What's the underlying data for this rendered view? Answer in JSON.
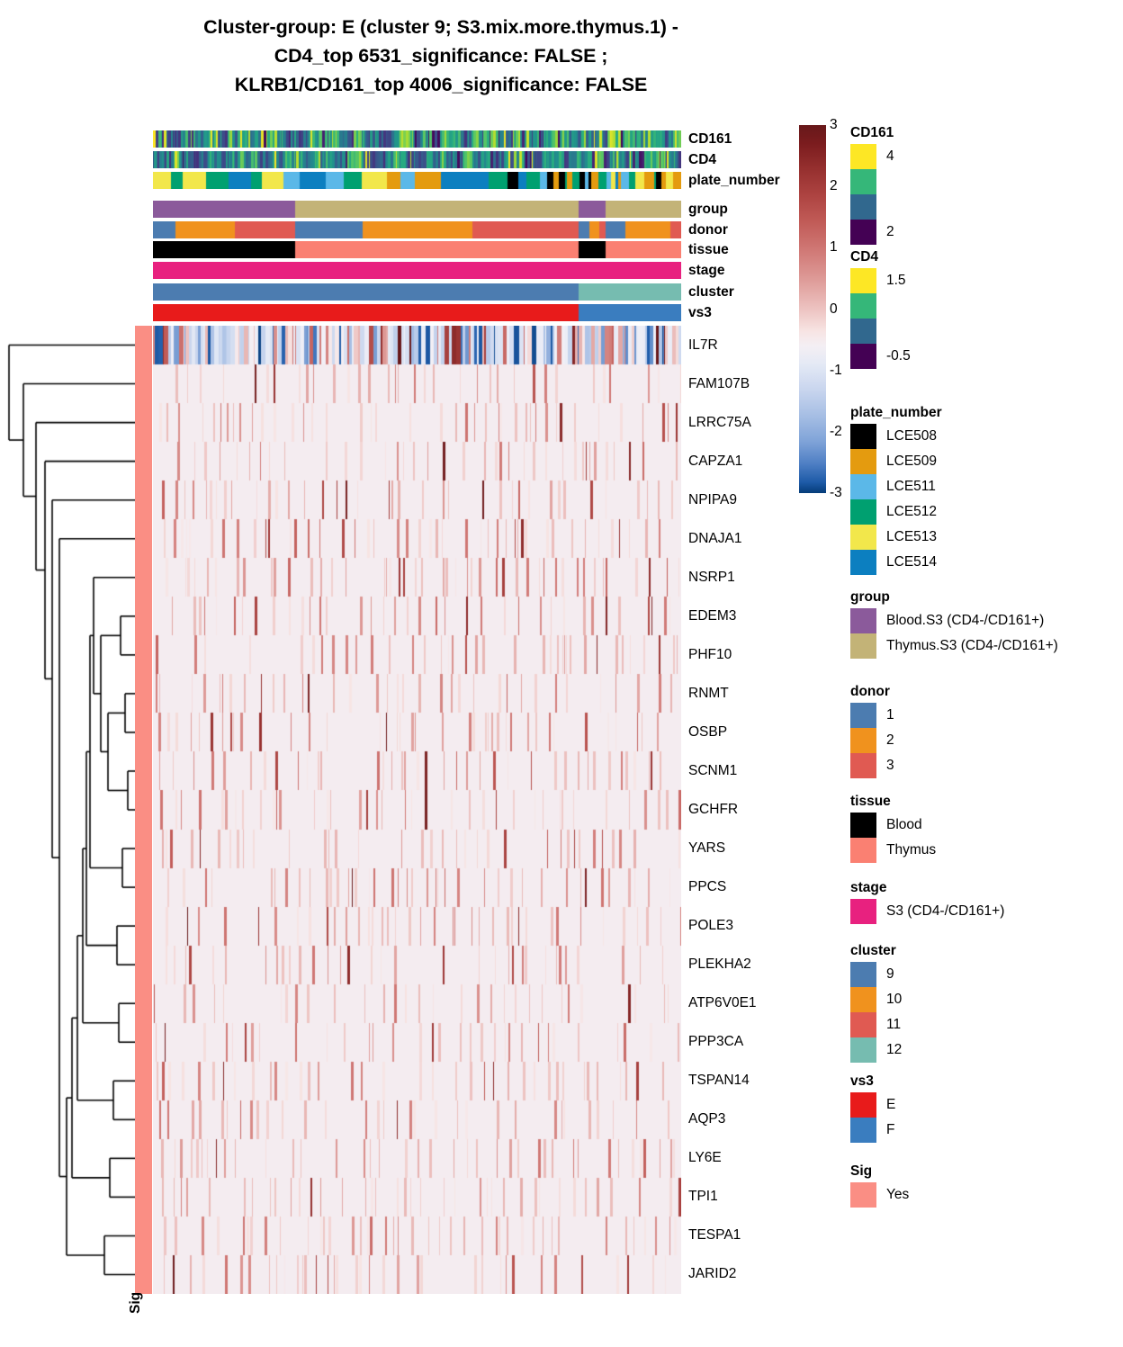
{
  "title": {
    "line1": "Cluster-group: E (cluster 9; S3.mix.more.thymus.1) -",
    "line2": "CD4_top 6531_significance: FALSE ;",
    "line3": "KLRB1/CD161_top 4006_significance: FALSE"
  },
  "column_annotations": [
    {
      "name": "CD161",
      "type": "continuous",
      "colormap": "viridis"
    },
    {
      "name": "CD4",
      "type": "continuous",
      "colormap": "viridis"
    },
    {
      "name": "plate_number",
      "type": "categorical"
    },
    {
      "name": "group",
      "type": "categorical"
    },
    {
      "name": "donor",
      "type": "categorical"
    },
    {
      "name": "tissue",
      "type": "categorical"
    },
    {
      "name": "stage",
      "type": "categorical"
    },
    {
      "name": "cluster",
      "type": "categorical"
    },
    {
      "name": "vs3",
      "type": "categorical"
    }
  ],
  "row_labels": [
    "IL7R",
    "FAM107B",
    "LRRC75A",
    "CAPZA1",
    "NPIPA9",
    "DNAJA1",
    "NSRP1",
    "EDEM3",
    "PHF10",
    "RNMT",
    "OSBP",
    "SCNM1",
    "GCHFR",
    "YARS",
    "PPCS",
    "POLE3",
    "PLEKHA2",
    "ATP6V0E1",
    "PPP3CA",
    "TSPAN14",
    "AQP3",
    "LY6E",
    "TPI1",
    "TESPA1",
    "JARID2"
  ],
  "sig_side_label": "Sig",
  "colorbar": {
    "ticks": [
      "3",
      "2",
      "1",
      "0",
      "-1",
      "-2",
      "-3"
    ],
    "min": -3,
    "max": 3,
    "high_color": "#67181A",
    "mid_color": "#F4EFF4",
    "low_color": "#053C78"
  },
  "legends": [
    {
      "title": "CD161",
      "style": "continuous-binned",
      "swatches": [
        "#FDE725",
        "#35B779",
        "#31688E",
        "#440154"
      ],
      "tick_labels": [
        "4",
        "",
        "",
        "2"
      ]
    },
    {
      "title": "CD4",
      "style": "continuous-binned",
      "swatches": [
        "#FDE725",
        "#35B779",
        "#31688E",
        "#440154"
      ],
      "tick_labels": [
        "1.5",
        "",
        "",
        "-0.5"
      ]
    },
    {
      "title": "plate_number",
      "style": "discrete",
      "items": [
        {
          "label": "LCE508",
          "color": "#000000"
        },
        {
          "label": "LCE509",
          "color": "#E49B0F"
        },
        {
          "label": "LCE511",
          "color": "#5BB8E8"
        },
        {
          "label": "LCE512",
          "color": "#00A070"
        },
        {
          "label": "LCE513",
          "color": "#F2E74B"
        },
        {
          "label": "LCE514",
          "color": "#0C7FC0"
        }
      ]
    },
    {
      "title": "group",
      "style": "discrete",
      "items": [
        {
          "label": "Blood.S3 (CD4-/CD161+)",
          "color": "#8B5A9B"
        },
        {
          "label": "Thymus.S3 (CD4-/CD161+)",
          "color": "#C3B377"
        }
      ]
    },
    {
      "title": "donor",
      "style": "discrete",
      "items": [
        {
          "label": "1",
          "color": "#4C7CB0"
        },
        {
          "label": "2",
          "color": "#F0921E"
        },
        {
          "label": "3",
          "color": "#E05A52"
        }
      ]
    },
    {
      "title": "tissue",
      "style": "discrete",
      "items": [
        {
          "label": "Blood",
          "color": "#000000"
        },
        {
          "label": "Thymus",
          "color": "#FA8072"
        }
      ]
    },
    {
      "title": "stage",
      "style": "discrete",
      "items": [
        {
          "label": "S3 (CD4-/CD161+)",
          "color": "#E8217F"
        }
      ]
    },
    {
      "title": "cluster",
      "style": "discrete",
      "items": [
        {
          "label": "9",
          "color": "#4C7CB0"
        },
        {
          "label": "10",
          "color": "#F0921E"
        },
        {
          "label": "11",
          "color": "#E05A52"
        },
        {
          "label": "12",
          "color": "#76BCB0"
        }
      ]
    },
    {
      "title": "vs3",
      "style": "discrete",
      "items": [
        {
          "label": "E",
          "color": "#E81B1B"
        },
        {
          "label": "F",
          "color": "#3A7DBF"
        }
      ]
    },
    {
      "title": "Sig",
      "style": "discrete",
      "items": [
        {
          "label": "Yes",
          "color": "#FA8E84"
        }
      ]
    }
  ],
  "chart_data": {
    "type": "heatmap",
    "title": "Cluster-group: E (cluster 9; S3.mix.more.thymus.1) - CD4_top 6531_significance: FALSE ; KLRB1/CD161_top 4006_significance: FALSE",
    "xlabel": "",
    "ylabel": "",
    "n_columns": 587,
    "n_rows": 25,
    "value_range": [
      -3,
      3
    ],
    "row_order": [
      "IL7R",
      "FAM107B",
      "LRRC75A",
      "CAPZA1",
      "NPIPA9",
      "DNAJA1",
      "NSRP1",
      "EDEM3",
      "PHF10",
      "RNMT",
      "OSBP",
      "SCNM1",
      "GCHFR",
      "YARS",
      "PPCS",
      "POLE3",
      "PLEKHA2",
      "ATP6V0E1",
      "PPP3CA",
      "TSPAN14",
      "AQP3",
      "LY6E",
      "TPI1",
      "TESPA1",
      "JARID2"
    ],
    "row_dendrogram": true,
    "column_dendrogram": false,
    "legend_position": "right",
    "grid": false,
    "annotation_blocks": {
      "group": [
        {
          "label": "Blood.S3 (CD4-/CD161+)",
          "start": 0.0,
          "end": 0.27
        },
        {
          "label": "Thymus.S3 (CD4-/CD161+)",
          "start": 0.27,
          "end": 0.805
        },
        {
          "label": "Blood.S3 (CD4-/CD161+)",
          "start": 0.805,
          "end": 0.857
        },
        {
          "label": "Thymus.S3 (CD4-/CD161+)",
          "start": 0.857,
          "end": 1.0
        }
      ],
      "donor": [
        {
          "label": "1",
          "start": 0.0,
          "end": 0.043
        },
        {
          "label": "2",
          "start": 0.043,
          "end": 0.155
        },
        {
          "label": "3",
          "start": 0.155,
          "end": 0.27
        },
        {
          "label": "1",
          "start": 0.27,
          "end": 0.397
        },
        {
          "label": "2",
          "start": 0.397,
          "end": 0.604
        },
        {
          "label": "3",
          "start": 0.604,
          "end": 0.805
        },
        {
          "label": "1",
          "start": 0.805,
          "end": 0.826
        },
        {
          "label": "2",
          "start": 0.826,
          "end": 0.845
        },
        {
          "label": "3",
          "start": 0.845,
          "end": 0.857
        },
        {
          "label": "1",
          "start": 0.857,
          "end": 0.894
        },
        {
          "label": "2",
          "start": 0.894,
          "end": 0.979
        },
        {
          "label": "3",
          "start": 0.979,
          "end": 1.0
        }
      ],
      "tissue": [
        {
          "label": "Blood",
          "start": 0.0,
          "end": 0.27
        },
        {
          "label": "Thymus",
          "start": 0.27,
          "end": 0.805
        },
        {
          "label": "Blood",
          "start": 0.805,
          "end": 0.857
        },
        {
          "label": "Thymus",
          "start": 0.857,
          "end": 1.0
        }
      ],
      "stage": [
        {
          "label": "S3 (CD4-/CD161+)",
          "start": 0.0,
          "end": 1.0
        }
      ],
      "cluster": [
        {
          "label": "9",
          "start": 0.0,
          "end": 0.805
        },
        {
          "label": "12",
          "start": 0.805,
          "end": 1.0
        }
      ],
      "vs3": [
        {
          "label": "E",
          "start": 0.0,
          "end": 0.805
        },
        {
          "label": "F",
          "start": 0.805,
          "end": 1.0
        }
      ]
    }
  }
}
